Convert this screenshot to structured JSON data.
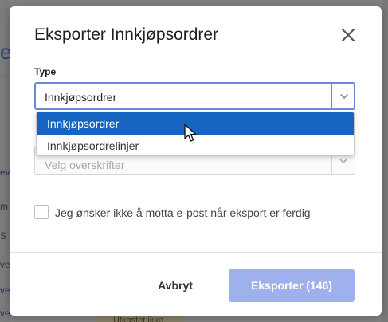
{
  "background": {
    "big_letter": "e",
    "side_fragments": [
      "ev",
      "m",
      "S",
      "ve",
      "ve",
      "ve"
    ],
    "bottom_label": "Utkastet ikke"
  },
  "modal": {
    "title": "Eksporter Innkjøpsordrer",
    "close_icon": "close-icon"
  },
  "type_field": {
    "label": "Type",
    "selected_value": "Innkjøpsordrer",
    "chevron_icon": "chevron-down-icon"
  },
  "dropdown": {
    "options": [
      {
        "label": "Innkjøpsordrer",
        "highlighted": true
      },
      {
        "label": "Innkjøpsordrelinjer",
        "highlighted": false
      }
    ]
  },
  "headers_field": {
    "placeholder": "Velg overskrifter",
    "chevron_icon": "chevron-down-icon"
  },
  "email_opt_out": {
    "label": "Jeg ønsker ikke å motta e-post når eksport er ferdig",
    "checked": false
  },
  "footer": {
    "cancel_label": "Avbryt",
    "export_label": "Eksporter (146)"
  },
  "colors": {
    "accent": "#6f86e0",
    "dropdown_highlight": "#1565c0",
    "export_button": "#9fb1ec"
  }
}
